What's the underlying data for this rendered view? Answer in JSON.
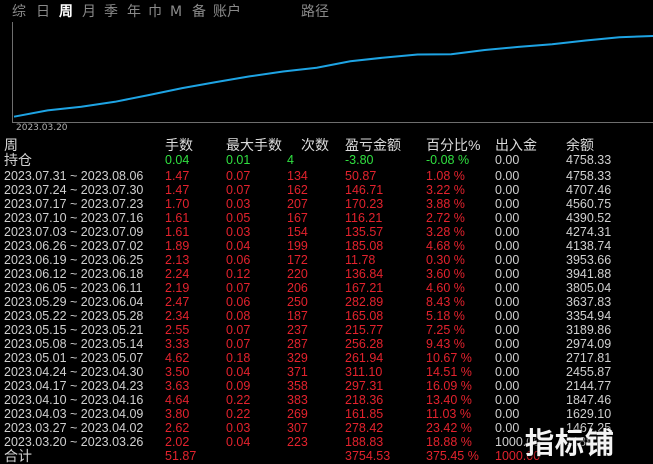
{
  "tabs": [
    {
      "label": "综",
      "active": false
    },
    {
      "label": "日",
      "active": false
    },
    {
      "label": "周",
      "active": true
    },
    {
      "label": "月",
      "active": false
    },
    {
      "label": "季",
      "active": false
    },
    {
      "label": "年",
      "active": false
    },
    {
      "label": "巾",
      "active": false
    },
    {
      "label": "M",
      "active": false
    },
    {
      "label": "备",
      "active": false
    },
    {
      "label": "账户",
      "active": false
    },
    {
      "label": "路径",
      "active": false
    }
  ],
  "chart_data": {
    "type": "line",
    "title": "",
    "x": [
      "2023.03.20",
      "2023.03.27",
      "2023.04.03",
      "2023.04.10",
      "2023.04.17",
      "2023.04.24",
      "2023.05.01",
      "2023.05.08",
      "2023.05.15",
      "2023.05.22",
      "2023.05.29",
      "2023.06.05",
      "2023.06.12",
      "2023.06.19",
      "2023.06.26",
      "2023.07.03",
      "2023.07.10",
      "2023.07.17",
      "2023.07.24",
      "2023.07.31"
    ],
    "series": [
      {
        "values": [
          1188.83,
          1467.25,
          1629.1,
          1847.46,
          2144.77,
          2455.87,
          2717.81,
          2974.09,
          3189.86,
          3354.94,
          3637.83,
          3805.04,
          3941.88,
          3953.66,
          4138.74,
          4274.31,
          4390.52,
          4560.75,
          4707.46,
          4758.33
        ]
      }
    ],
    "first_x_label": "2023.03.20",
    "color": "#1ea4e4",
    "grid": false
  },
  "table": {
    "headers": {
      "week": "周",
      "lots": "手数",
      "max_lots": "最大手数",
      "count": "次数",
      "pl": "盈亏金额",
      "pct": "百分比%",
      "deposit": "出入金",
      "balance": "余额"
    },
    "holding": {
      "label": "持仓",
      "lots": "0.04",
      "max_lots": "0.01",
      "count": "4",
      "pl": "-3.80",
      "pct": "-0.08 %",
      "deposit": "0.00",
      "balance": "4758.33"
    },
    "rows": [
      {
        "week": "2023.07.31 ~ 2023.08.06",
        "lots": "1.47",
        "max_lots": "0.07",
        "count": "134",
        "pl": "50.87",
        "pct": "1.08 %",
        "deposit": "0.00",
        "balance": "4758.33"
      },
      {
        "week": "2023.07.24 ~ 2023.07.30",
        "lots": "1.47",
        "max_lots": "0.07",
        "count": "162",
        "pl": "146.71",
        "pct": "3.22 %",
        "deposit": "0.00",
        "balance": "4707.46"
      },
      {
        "week": "2023.07.17 ~ 2023.07.23",
        "lots": "1.70",
        "max_lots": "0.03",
        "count": "207",
        "pl": "170.23",
        "pct": "3.88 %",
        "deposit": "0.00",
        "balance": "4560.75"
      },
      {
        "week": "2023.07.10 ~ 2023.07.16",
        "lots": "1.61",
        "max_lots": "0.05",
        "count": "167",
        "pl": "116.21",
        "pct": "2.72 %",
        "deposit": "0.00",
        "balance": "4390.52"
      },
      {
        "week": "2023.07.03 ~ 2023.07.09",
        "lots": "1.61",
        "max_lots": "0.03",
        "count": "154",
        "pl": "135.57",
        "pct": "3.28 %",
        "deposit": "0.00",
        "balance": "4274.31"
      },
      {
        "week": "2023.06.26 ~ 2023.07.02",
        "lots": "1.89",
        "max_lots": "0.04",
        "count": "199",
        "pl": "185.08",
        "pct": "4.68 %",
        "deposit": "0.00",
        "balance": "4138.74"
      },
      {
        "week": "2023.06.19 ~ 2023.06.25",
        "lots": "2.13",
        "max_lots": "0.06",
        "count": "172",
        "pl": "11.78",
        "pct": "0.30 %",
        "deposit": "0.00",
        "balance": "3953.66"
      },
      {
        "week": "2023.06.12 ~ 2023.06.18",
        "lots": "2.24",
        "max_lots": "0.12",
        "count": "220",
        "pl": "136.84",
        "pct": "3.60 %",
        "deposit": "0.00",
        "balance": "3941.88"
      },
      {
        "week": "2023.06.05 ~ 2023.06.11",
        "lots": "2.19",
        "max_lots": "0.07",
        "count": "206",
        "pl": "167.21",
        "pct": "4.60 %",
        "deposit": "0.00",
        "balance": "3805.04"
      },
      {
        "week": "2023.05.29 ~ 2023.06.04",
        "lots": "2.47",
        "max_lots": "0.06",
        "count": "250",
        "pl": "282.89",
        "pct": "8.43 %",
        "deposit": "0.00",
        "balance": "3637.83"
      },
      {
        "week": "2023.05.22 ~ 2023.05.28",
        "lots": "2.34",
        "max_lots": "0.08",
        "count": "187",
        "pl": "165.08",
        "pct": "5.18 %",
        "deposit": "0.00",
        "balance": "3354.94"
      },
      {
        "week": "2023.05.15 ~ 2023.05.21",
        "lots": "2.55",
        "max_lots": "0.07",
        "count": "237",
        "pl": "215.77",
        "pct": "7.25 %",
        "deposit": "0.00",
        "balance": "3189.86"
      },
      {
        "week": "2023.05.08 ~ 2023.05.14",
        "lots": "3.33",
        "max_lots": "0.07",
        "count": "287",
        "pl": "256.28",
        "pct": "9.43 %",
        "deposit": "0.00",
        "balance": "2974.09"
      },
      {
        "week": "2023.05.01 ~ 2023.05.07",
        "lots": "4.62",
        "max_lots": "0.18",
        "count": "329",
        "pl": "261.94",
        "pct": "10.67 %",
        "deposit": "0.00",
        "balance": "2717.81"
      },
      {
        "week": "2023.04.24 ~ 2023.04.30",
        "lots": "3.50",
        "max_lots": "0.04",
        "count": "371",
        "pl": "311.10",
        "pct": "14.51 %",
        "deposit": "0.00",
        "balance": "2455.87"
      },
      {
        "week": "2023.04.17 ~ 2023.04.23",
        "lots": "3.63",
        "max_lots": "0.09",
        "count": "358",
        "pl": "297.31",
        "pct": "16.09 %",
        "deposit": "0.00",
        "balance": "2144.77"
      },
      {
        "week": "2023.04.10 ~ 2023.04.16",
        "lots": "4.64",
        "max_lots": "0.22",
        "count": "383",
        "pl": "218.36",
        "pct": "13.40 %",
        "deposit": "0.00",
        "balance": "1847.46"
      },
      {
        "week": "2023.04.03 ~ 2023.04.09",
        "lots": "3.80",
        "max_lots": "0.22",
        "count": "269",
        "pl": "161.85",
        "pct": "11.03 %",
        "deposit": "0.00",
        "balance": "1629.10"
      },
      {
        "week": "2023.03.27 ~ 2023.04.02",
        "lots": "2.62",
        "max_lots": "0.03",
        "count": "307",
        "pl": "278.42",
        "pct": "23.42 %",
        "deposit": "0.00",
        "balance": "1467.25"
      },
      {
        "week": "2023.03.20 ~ 2023.03.26",
        "lots": "2.02",
        "max_lots": "0.04",
        "count": "223",
        "pl": "188.83",
        "pct": "18.88 %",
        "deposit": "1000.00",
        "balance": "1188.83"
      }
    ],
    "total": {
      "label": "合计",
      "lots": "51.87",
      "max_lots": "",
      "count": "",
      "pl": "3754.53",
      "pct": "375.45 %",
      "deposit": "1000.00",
      "balance": ""
    }
  },
  "colors": {
    "positive": "#e3222d",
    "holding": "#30e040",
    "line": "#1ea4e4",
    "background": "#000000"
  },
  "watermark": "指标铺"
}
